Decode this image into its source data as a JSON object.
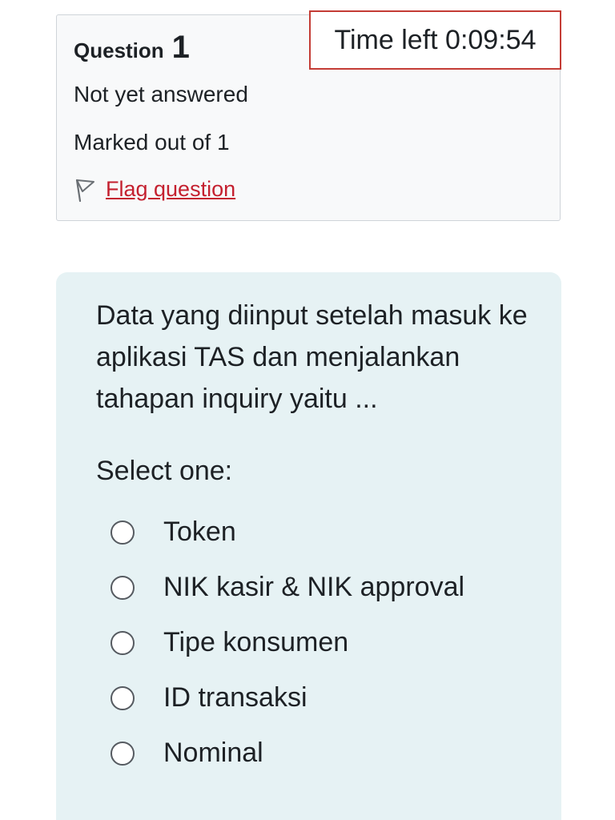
{
  "info": {
    "question_word": "Question",
    "question_number": "1",
    "state": "Not yet answered",
    "grade": "Marked out of 1",
    "flag_label": "Flag question"
  },
  "timer": {
    "text": "Time left 0:09:54"
  },
  "question": {
    "text": "Data yang diinput setelah masuk ke aplikasi TAS dan menjalankan tahapan inquiry yaitu ...",
    "prompt": "Select one:",
    "options": [
      {
        "label": "Token"
      },
      {
        "label": "NIK kasir & NIK approval"
      },
      {
        "label": "Tipe konsumen"
      },
      {
        "label": "ID transaksi"
      },
      {
        "label": "Nominal"
      }
    ]
  },
  "colors": {
    "link": "#c4202f",
    "timer_border": "#c43c35",
    "question_bg": "#e6f2f4",
    "info_bg": "#f8f9fa"
  },
  "icons": {
    "flag": "flag-icon",
    "radio": "radio-unchecked-icon"
  }
}
